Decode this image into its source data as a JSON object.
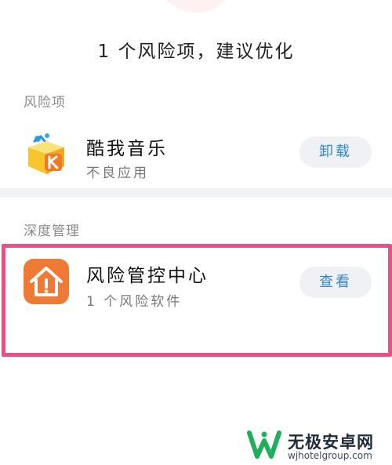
{
  "summary": {
    "text": "1 个风险项，建议优化"
  },
  "risk_section": {
    "label": "风险项",
    "items": [
      {
        "name": "酷我音乐",
        "desc": "不良应用",
        "action": "卸载",
        "icon": "kuwo-music-app-icon"
      }
    ]
  },
  "deep_section": {
    "label": "深度管理",
    "items": [
      {
        "name": "风险管控中心",
        "desc": "1 个风险软件",
        "action": "查看",
        "icon": "house-warning-app-icon"
      }
    ]
  },
  "watermark": {
    "title": "无极安卓网",
    "url": "wjhotelgroup.com"
  },
  "colors": {
    "action_text": "#2f86d6",
    "action_bg": "#f0f1f4",
    "highlight": "#ea4f88",
    "risk_center_icon": "#ef7a35",
    "kuwo_yellow": "#f7c52c",
    "watermark_green": "#1fae5c"
  }
}
